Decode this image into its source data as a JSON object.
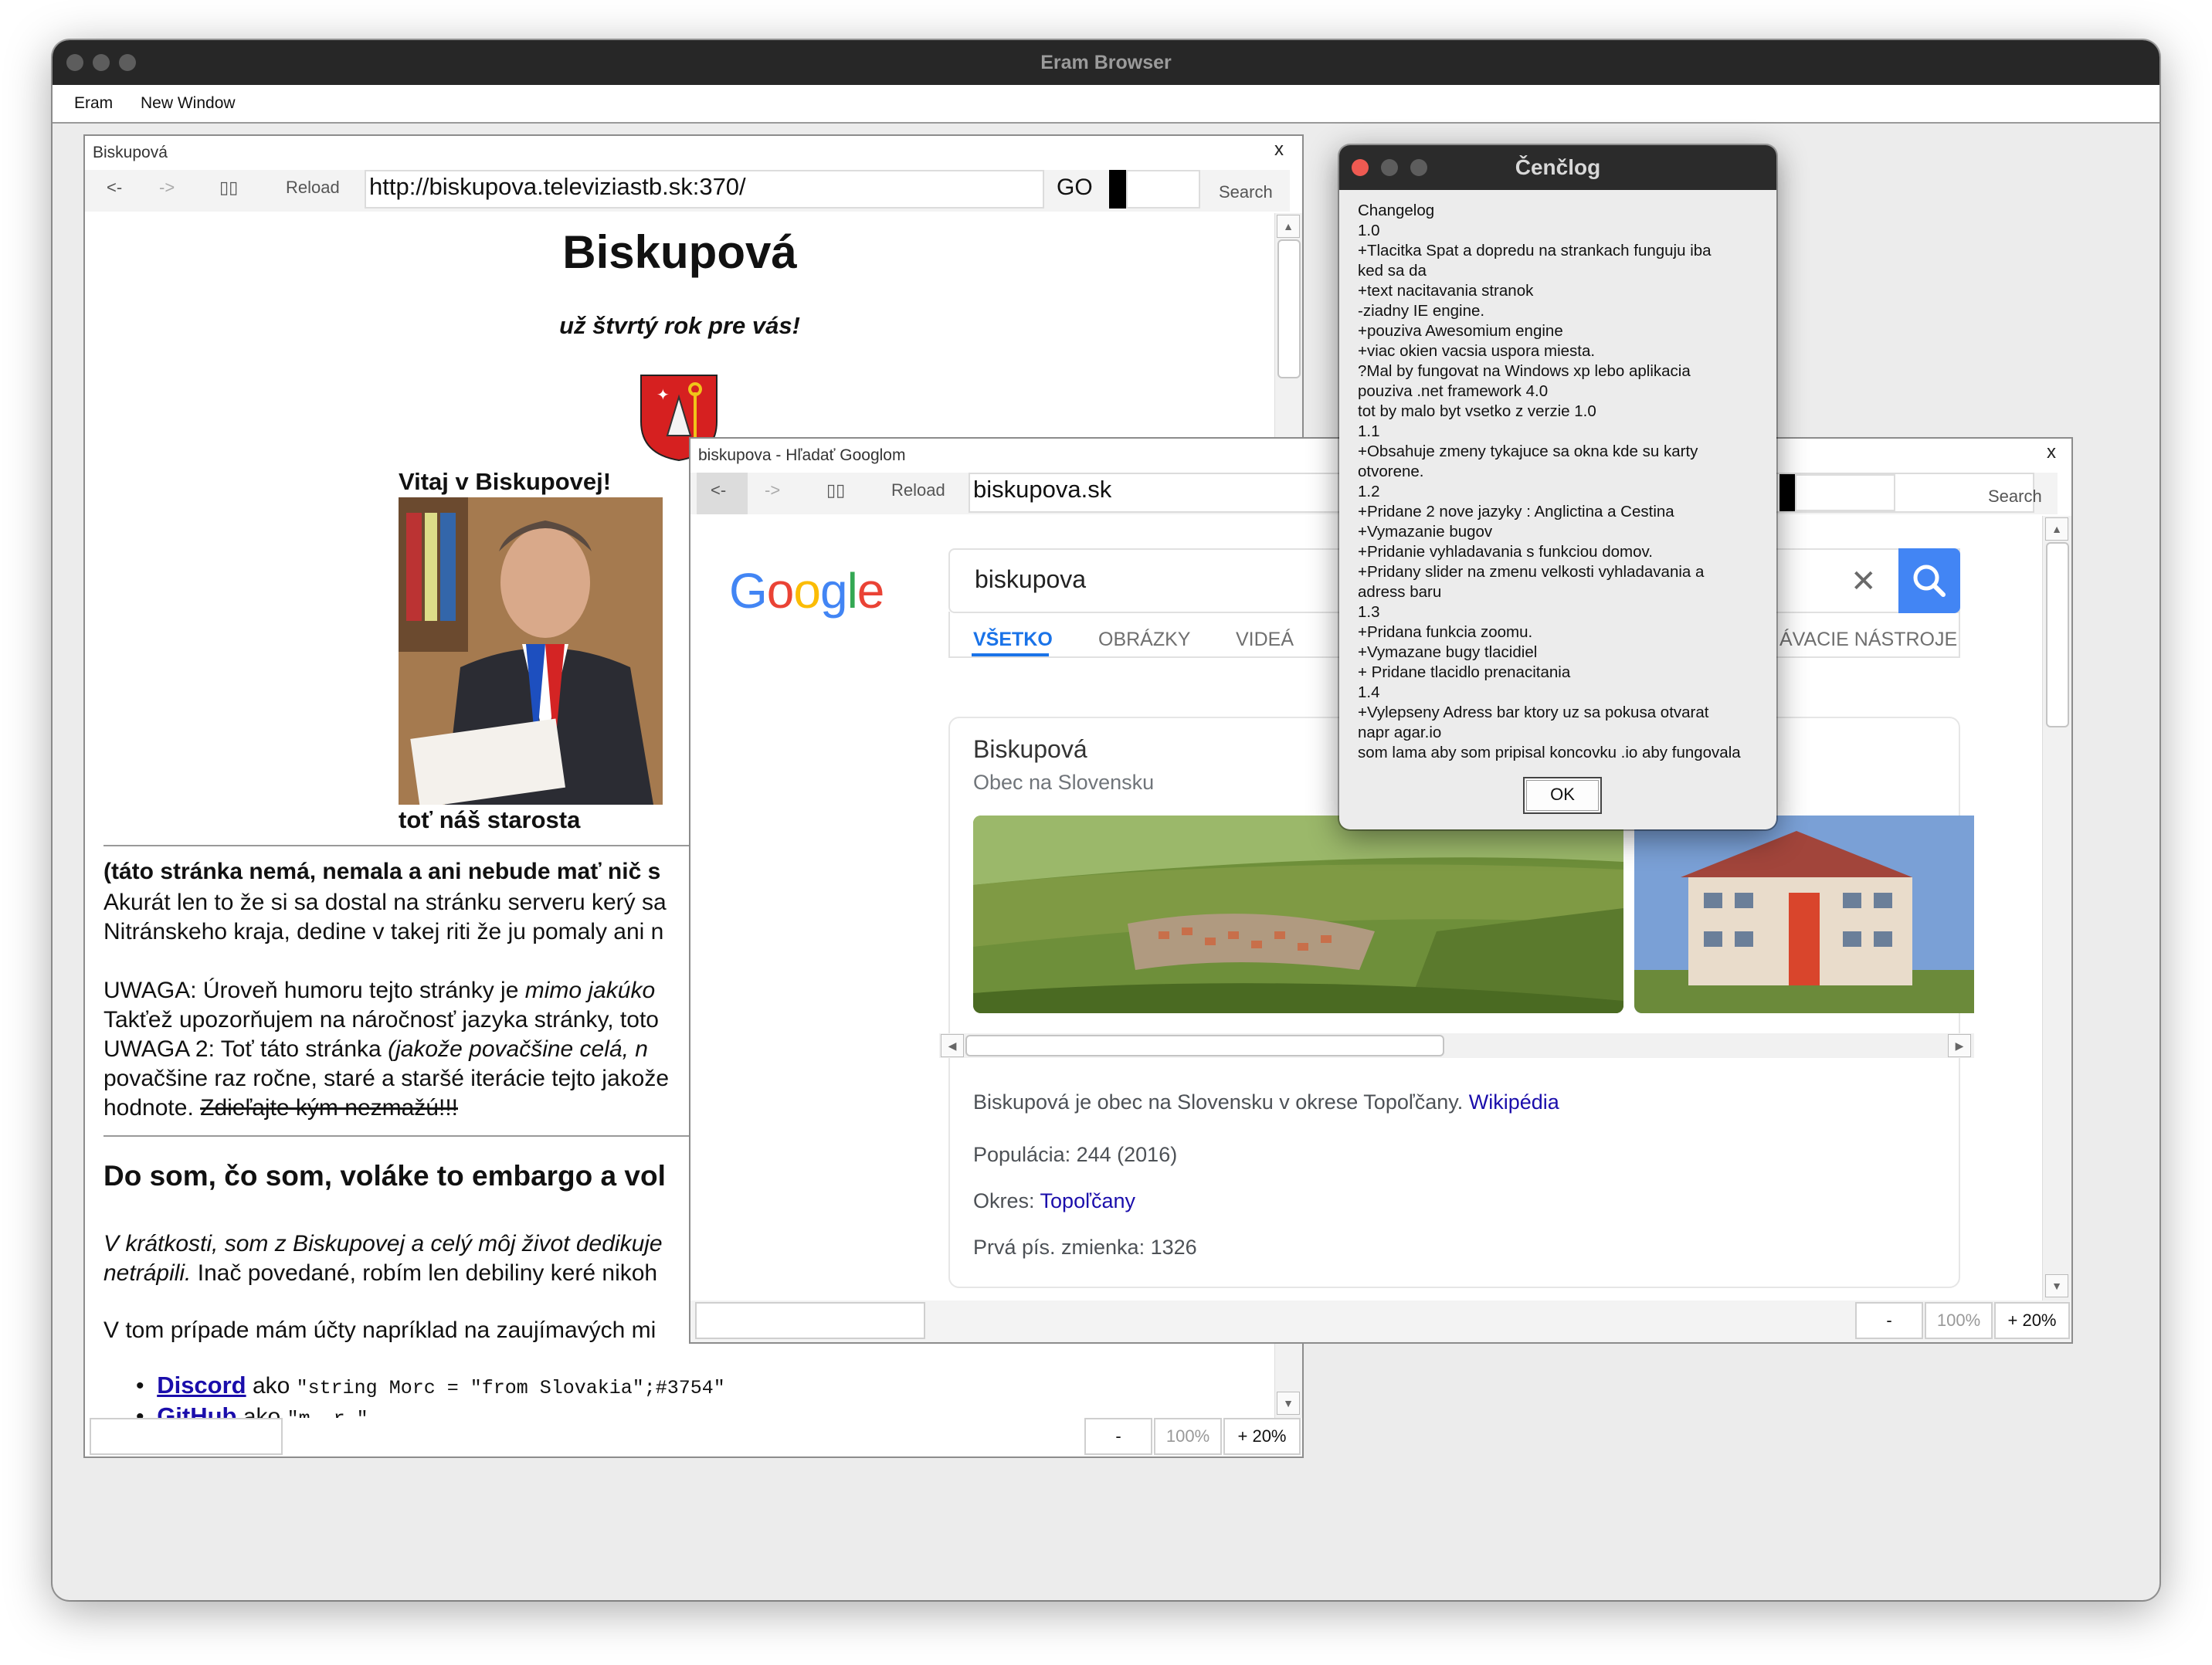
{
  "app": {
    "window_title": "Eram Browser",
    "menu": [
      "Eram",
      "New Window"
    ]
  },
  "window1": {
    "tab_title": "Biskupová",
    "close": "x",
    "back": "<-",
    "forward": "->",
    "stop": "▯▯",
    "reload": "Reload",
    "url": "http://biskupova.televiziastb.sk:370/",
    "go": "GO",
    "search": "Search",
    "zoom_minus": "-",
    "zoom_level": "100%",
    "zoom_plus": "+ 20%",
    "page": {
      "heading": "Biskupová",
      "subtitle": "už štvrtý rok pre vás!",
      "welcome": "Vitaj v Biskupovej!",
      "caption": "toť náš starosta",
      "disclaimer_bold": "(táto stránka nemá, nemala a ani nebude mať nič s",
      "line1": "Akurát len to že si sa dostal na stránku serveru kerý sa",
      "line2": "Nitránskeho kraja, dedine v takej riti že ju pomaly ani n",
      "uwaga1a": "UWAGA: Úroveň humoru tejto stránky je",
      "uwaga1b": "mimo jakúko",
      "uwaga1c": "Takťež upozorňujem na náročnosť jazyka stránky, toto",
      "uwaga2a": "UWAGA 2: Toť táto stránka",
      "uwaga2b": "(jakože povačšine celá, n",
      "uwaga2c": "povačšine raz ročne, staré a staršé iterácie tejto jakože",
      "uwaga2d": "hodnote.",
      "uwaga2e": "Zdieľajte kým nezmažú!!!",
      "section": "Do som, čo som, voláke to embargo a vol",
      "para1a": "V krátkosti, som z Biskupovej a celý môj život dedikuje",
      "para1b": "netrápili.",
      "para1c": "Inač povedané, robím len debiliny keré nikoh",
      "para2": "V tom prípade mám účty napríklad na zaujímavých mi",
      "li1_link": "Discord",
      "li1_text": "ako",
      "li1_code": "\"string Morc = \"from Slovakia\";#3754\"",
      "li2_link": "GitHub",
      "li2_text": "ako",
      "li2_code": "\"m_ r \""
    }
  },
  "window2": {
    "tab_title": "biskupova - Hľadať Googlom",
    "close": "x",
    "back": "<-",
    "forward": "->",
    "stop": "▯▯",
    "reload": "Reload",
    "url": "biskupova.sk",
    "search": "Search",
    "zoom_minus": "-",
    "zoom_level": "100%",
    "zoom_plus": "+ 20%",
    "google": {
      "logo": "Google",
      "query": "biskupova",
      "tabs": [
        "VŠETKO",
        "OBRÁZKY",
        "VIDEÁ",
        "ÁVACIE NÁSTROJE"
      ],
      "kp_title": "Biskupová",
      "kp_subtitle": "Obec na Slovensku",
      "description": "Biskupová je obec na Slovensku v okrese Topoľčany.",
      "wiki": "Wikipédia",
      "pop_label": "Populácia:",
      "pop_value": "244 (2016)",
      "okres_label": "Okres:",
      "okres_value": "Topoľčany",
      "first_label": "Prvá pís. zmienka:",
      "first_value": "1326"
    }
  },
  "dialog": {
    "title": "Čenčlog",
    "body": "Changelog\n1.0\n+Tlacitka Spat a dopredu na strankach funguju iba\nked sa da\n+text nacitavania stranok\n-ziadny IE engine.\n+pouziva Awesomium engine\n+viac okien vacsia uspora miesta.\n?Mal by fungovat na Windows xp lebo aplikacia\npouziva .net framework 4.0\ntot by malo byt vsetko z verzie 1.0\n1.1\n+Obsahuje zmeny tykajuce sa okna kde su karty\notvorene.\n1.2\n+Pridane 2 nove jazyky : Anglictina a Cestina\n+Vymazanie bugov\n+Pridanie vyhladavania s funkciou domov.\n+Pridany slider na zmenu velkosti vyhladavania a\nadress baru\n1.3\n+Pridana funkcia zoomu.\n+Vymazane bugy tlacidiel\n+ Pridane tlacidlo prenacitania\n1.4\n+Vylepseny Adress bar ktory uz sa pokusa otvarat\nnapr agar.io\nsom lama aby som pripisal koncovku .io aby fungovala",
    "ok": "OK"
  },
  "colors": {
    "titlebar": "#272727",
    "close_red": "#ee5a52",
    "google_blue": "#4285f4",
    "link": "#1a0dab"
  }
}
